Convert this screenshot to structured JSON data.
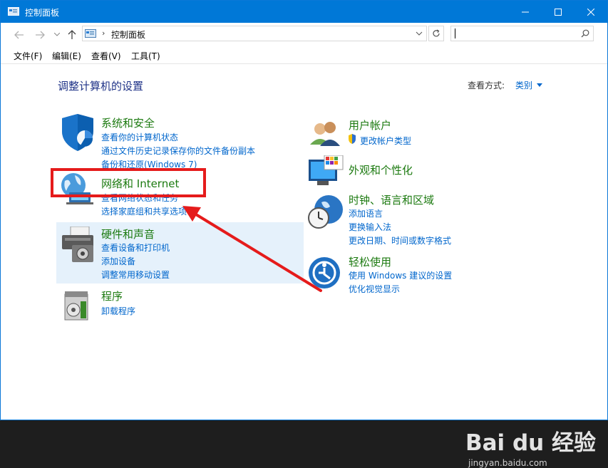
{
  "window": {
    "title": "控制面板"
  },
  "address": {
    "crumb": "控制面板"
  },
  "menu": [
    "文件(F)",
    "编辑(E)",
    "查看(V)",
    "工具(T)"
  ],
  "main": {
    "title": "调整计算机的设置",
    "viewby_label": "查看方式:",
    "viewby_value": "类别"
  },
  "categories": {
    "system": {
      "title": "系统和安全",
      "links": [
        "查看你的计算机状态",
        "通过文件历史记录保存你的文件备份副本",
        "备份和还原(Windows 7)"
      ]
    },
    "network": {
      "title": "网络和 Internet",
      "links": [
        "查看网络状态和任务",
        "选择家庭组和共享选项"
      ]
    },
    "hardware": {
      "title": "硬件和声音",
      "links": [
        "查看设备和打印机",
        "添加设备",
        "调整常用移动设置"
      ]
    },
    "programs": {
      "title": "程序",
      "links": [
        "卸载程序"
      ]
    },
    "user": {
      "title": "用户帐户",
      "links": [
        "更改帐户类型"
      ]
    },
    "appearance": {
      "title": "外观和个性化",
      "links": []
    },
    "clock": {
      "title": "时钟、语言和区域",
      "links": [
        "添加语言",
        "更换输入法",
        "更改日期、时间或数字格式"
      ]
    },
    "ease": {
      "title": "轻松使用",
      "links": [
        "使用 Windows 建议的设置",
        "优化视觉显示"
      ]
    }
  },
  "watermark": {
    "main": "Bai du 经验",
    "sub": "jingyan.baidu.com"
  },
  "colors": {
    "titlebar": "#0078d7",
    "category_title": "#1c7a10",
    "link": "#0066cc",
    "highlight": "#e5f1fb",
    "annotation": "#e51b1b"
  }
}
